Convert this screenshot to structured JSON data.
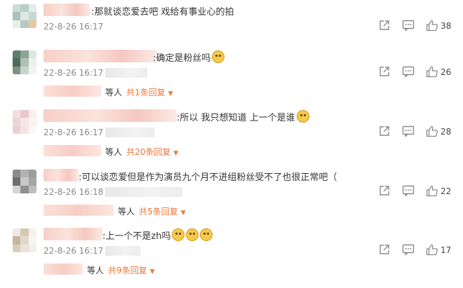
{
  "comments": [
    {
      "text": ":那就谈恋爱去吧 戏给有事业心的拍",
      "emojis": 0,
      "time": "22-8-26 16:17",
      "likes": "38",
      "replies": null,
      "avatar_colors": [
        "#c9ded6",
        "#b8d0c8",
        "#e6ede9",
        "#a9c1b9",
        "#dfe8e4",
        "#c5d9d1",
        "#e9efe7",
        "#b5cbc1",
        "#e2c8a4"
      ]
    },
    {
      "text": ":确定是粉丝吗",
      "emojis": 1,
      "time": "22-8-26 16:17",
      "likes": "26",
      "replies": {
        "etc": "等人",
        "count": "共1条回复"
      },
      "avatar_colors": [
        "#5f7d67",
        "#8ea594",
        "#dfe6e0",
        "#4d6b56",
        "#aec0b2",
        "#ecefec",
        "#7c9482",
        "#c9d4cb",
        "#f1f3f1"
      ]
    },
    {
      "text": ":所以 我只想知道 上一个是谁",
      "emojis": 1,
      "time": "22-8-26 16:17",
      "likes": "28",
      "replies": {
        "etc": "等人",
        "count": "共20条回复"
      },
      "avatar_colors": [
        "#f3dfe0",
        "#e9c8cb",
        "#f9eeee",
        "#efd5d7",
        "#f6e6e7",
        "#fbf2f2",
        "#eccfd2",
        "#f5e3e4",
        "#fdf7f7"
      ]
    },
    {
      "text": ":可以谈恋爱但是作为演员九个月不进组粉丝受不了也很正常吧（",
      "emojis": 0,
      "time": "22-8-26 16:18",
      "likes": "22",
      "replies": {
        "etc": "等人",
        "count": "共5条回复"
      },
      "avatar_colors": [
        "#8a8a8a",
        "#b3b3b3",
        "#9c9c9c",
        "#6e6e6e",
        "#c8c8c8",
        "#a5a5a5",
        "#d4d4d4",
        "#8f8f8f",
        "#bdbdbd"
      ]
    },
    {
      "text": ":上一个不是zh吗",
      "emojis": 3,
      "time": "22-8-26 16:17",
      "likes": "17",
      "replies": {
        "etc": "等人",
        "count": "共9条回复"
      },
      "avatar_colors": [
        "#eeeae4",
        "#d6c8b4",
        "#f4f1ec",
        "#c8b69d",
        "#e3d9cb",
        "#f7f5f1",
        "#d9ccba",
        "#ebe3d8",
        "#f2eee8"
      ]
    }
  ]
}
